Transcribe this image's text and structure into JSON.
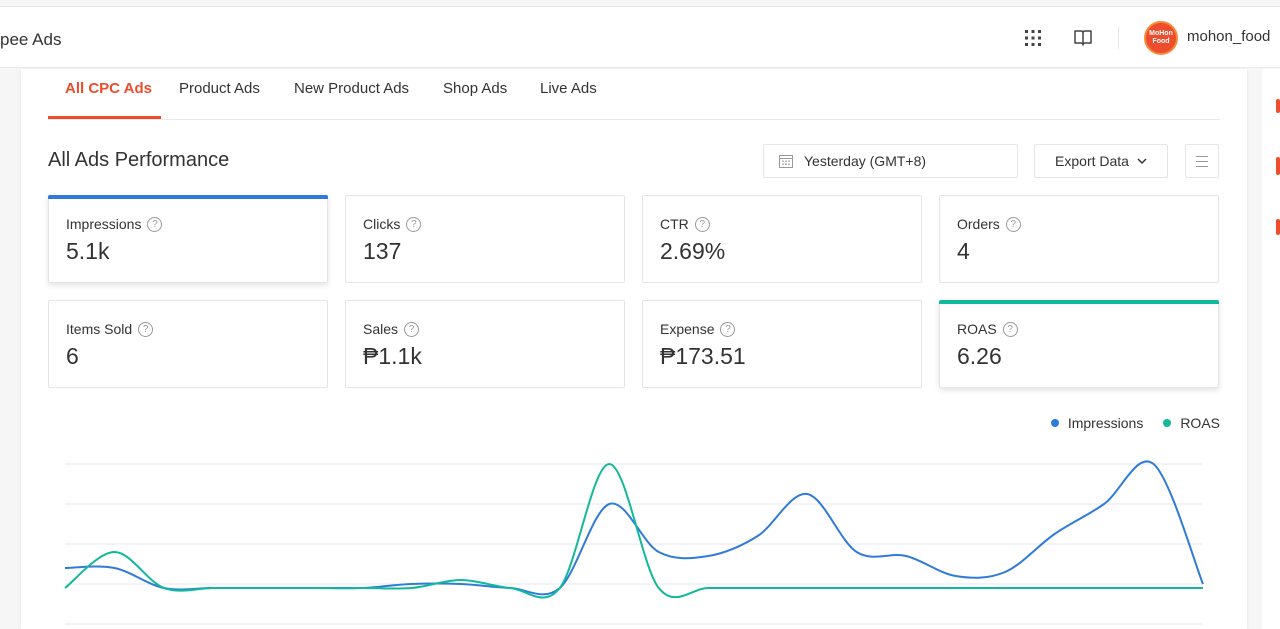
{
  "header": {
    "brand": "pee Ads",
    "username": "mohon_food",
    "avatar_text": "MoHon Food",
    "icons": [
      "apps-grid-icon",
      "book-icon"
    ]
  },
  "tabs": [
    {
      "label": "All CPC Ads",
      "active": true
    },
    {
      "label": "Product Ads",
      "active": false
    },
    {
      "label": "New Product Ads",
      "active": false
    },
    {
      "label": "Shop Ads",
      "active": false
    },
    {
      "label": "Live Ads",
      "active": false
    }
  ],
  "section": {
    "title": "All Ads Performance",
    "date_range": "Yesterday (GMT+8)",
    "export_label": "Export Data"
  },
  "metrics": [
    {
      "label": "Impressions",
      "value": "5.1k",
      "selected": true,
      "accent": "#2f7bd9"
    },
    {
      "label": "Clicks",
      "value": "137",
      "selected": false
    },
    {
      "label": "CTR",
      "value": "2.69%",
      "selected": false
    },
    {
      "label": "Orders",
      "value": "4",
      "selected": false
    },
    {
      "label": "Items Sold",
      "value": "6",
      "selected": false
    },
    {
      "label": "Sales",
      "value": "₱1.1k",
      "selected": false
    },
    {
      "label": "Expense",
      "value": "₱173.51",
      "selected": false
    },
    {
      "label": "ROAS",
      "value": "6.26",
      "selected": true,
      "accent": "#11b99a"
    }
  ],
  "colors": {
    "brand": "#ee4d2d",
    "impressions": "#2f7bd9",
    "roas": "#11b99a"
  },
  "chart_data": {
    "type": "line",
    "x": [
      0,
      1,
      2,
      3,
      4,
      5,
      6,
      7,
      8,
      9,
      10,
      11,
      12,
      13,
      14,
      15,
      16,
      17,
      18,
      19,
      20,
      21,
      22,
      23
    ],
    "series": [
      {
        "name": "Impressions",
        "values": [
          0.48,
          0.48,
          0.38,
          0.38,
          0.38,
          0.38,
          0.38,
          0.4,
          0.4,
          0.38,
          0.38,
          0.8,
          0.56,
          0.54,
          0.64,
          0.85,
          0.56,
          0.54,
          0.44,
          0.46,
          0.65,
          0.8,
          1.0,
          0.4
        ]
      },
      {
        "name": "ROAS",
        "values": [
          0.38,
          0.56,
          0.38,
          0.38,
          0.38,
          0.38,
          0.38,
          0.38,
          0.42,
          0.38,
          0.38,
          1.0,
          0.38,
          0.38,
          0.38,
          0.38,
          0.38,
          0.38,
          0.38,
          0.38,
          0.38,
          0.38,
          0.38,
          0.38
        ]
      }
    ],
    "legend": "top-right",
    "grid": true
  }
}
